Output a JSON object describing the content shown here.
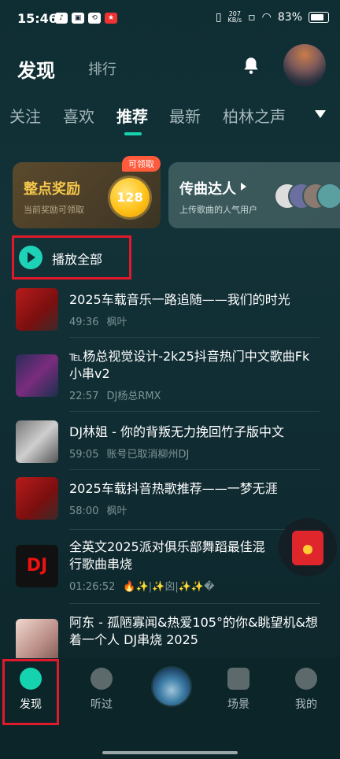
{
  "status_bar": {
    "time": "15:46",
    "speed_top": "207",
    "speed_bottom": "KB/s",
    "battery": "83%"
  },
  "header": {
    "title": "发现",
    "rank": "排行"
  },
  "tabs": [
    "关注",
    "喜欢",
    "推荐",
    "最新",
    "柏林之声"
  ],
  "active_tab_index": 2,
  "cards": {
    "reward": {
      "title": "整点奖励",
      "sub": "当前奖励可领取",
      "badge": "可领取",
      "coins": "128"
    },
    "artist": {
      "title": "传曲达人",
      "sub": "上传歌曲的人气用户"
    }
  },
  "play_all": "播放全部",
  "songs": [
    {
      "title": "2025车载音乐一路追随——我们的时光",
      "duration": "49:36",
      "artist": "枫叶"
    },
    {
      "title": "℡杨总视觉设计-2k25抖音热门中文歌曲Fk小串v2",
      "duration": "22:57",
      "artist": "DJ杨总RMX"
    },
    {
      "title": "DJ林姐 - 你的背叛无力挽回竹子版中文",
      "duration": "59:05",
      "artist": "账号已取消柳州DJ"
    },
    {
      "title": "2025车载抖音热歌推荐——一梦无涯",
      "duration": "58:00",
      "artist": "枫叶"
    },
    {
      "title": "全英文2025派对俱乐部舞蹈最佳混行歌曲串烧",
      "duration": "01:26:52",
      "artist": "🔥✨|✨囟|✨✨�"
    },
    {
      "title": "阿东 - 孤陋寡闻&热爱105°的你&眺望机&想着一个人 DJ串烧 2025",
      "duration": "",
      "artist": ""
    }
  ],
  "dj_cover_text": "DJ",
  "bottom_nav": [
    "发现",
    "听过",
    "场景",
    "我的"
  ]
}
